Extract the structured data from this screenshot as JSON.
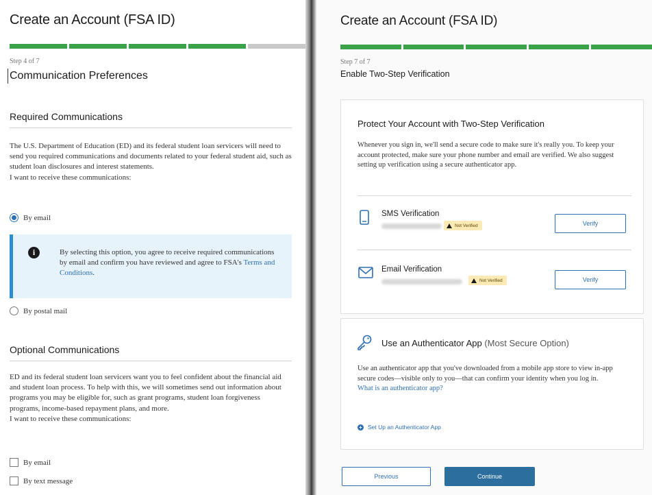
{
  "left": {
    "page_title": "Create an Account (FSA ID)",
    "progress": {
      "total_steps": 7,
      "completed_segments": 4
    },
    "step_label": "Step 4 of 7",
    "step_title": "Communication Preferences",
    "required": {
      "heading": "Required Communications",
      "paragraph": "The U.S. Department of Education (ED) and its federal student loan servicers will need to send you required communications and documents related to your federal student aid, such as student loan disclosures and interest statements.",
      "prompt": "I want to receive these communications:",
      "options": [
        {
          "label": "By email",
          "selected": true
        },
        {
          "label": "By postal mail",
          "selected": false
        }
      ],
      "info_text": "By selecting this option, you agree to receive required communications by email and confirm you have reviewed and agree to FSA's ",
      "info_link": "Terms and Conditions",
      "info_end": "."
    },
    "optional": {
      "heading": "Optional Communications",
      "paragraph": "ED and its federal student loan servicers want you to feel confident about the financial aid and student loan process. To help with this, we will sometimes send out information about programs you may be eligible for, such as grant programs, student loan forgiveness programs, income-based repayment plans, and more.",
      "prompt": "I want to receive these communications:",
      "options": [
        {
          "label": "By email",
          "checked": false
        },
        {
          "label": "By text message",
          "checked": false
        }
      ]
    }
  },
  "right": {
    "page_title": "Create an Account (FSA ID)",
    "progress": {
      "total_steps": 7,
      "completed_segments": 7
    },
    "step_label": "Step 7 of 7",
    "step_title": "Enable Two-Step Verification",
    "card1": {
      "title": "Protect Your Account with Two-Step Verification",
      "paragraph": "Whenever you sign in, we'll send a secure code to make sure it's really you. To keep your account protected, make sure your phone number and email are verified. We also suggest setting up verification using a secure authenticator app.",
      "sms": {
        "name": "SMS Verification",
        "badge": "Not Verified",
        "button": "Verify",
        "icon": "phone-icon"
      },
      "email": {
        "name": "Email Verification",
        "badge": "Not Verified",
        "button": "Verify",
        "icon": "envelope-icon"
      }
    },
    "card2": {
      "title": "Use an Authenticator App",
      "title_note": "(Most Secure Option)",
      "icon": "key-icon",
      "paragraph": "Use an authenticator app that you've downloaded from a mobile app store to view in-app secure codes—visible only to you—that can confirm your identity when you log in.",
      "link": "What is an authenticator app?",
      "setup_label": "Set Up an Authenticator App"
    },
    "buttons": {
      "previous": "Previous",
      "continue": "Continue"
    }
  },
  "colors": {
    "progress_done": "#3aa34a",
    "progress_todo": "#c9c9c9",
    "primary": "#2c6f9e",
    "link": "#2d6fb3",
    "info_bg": "#e7f3fa",
    "badge_bg": "#fbe9b6"
  }
}
